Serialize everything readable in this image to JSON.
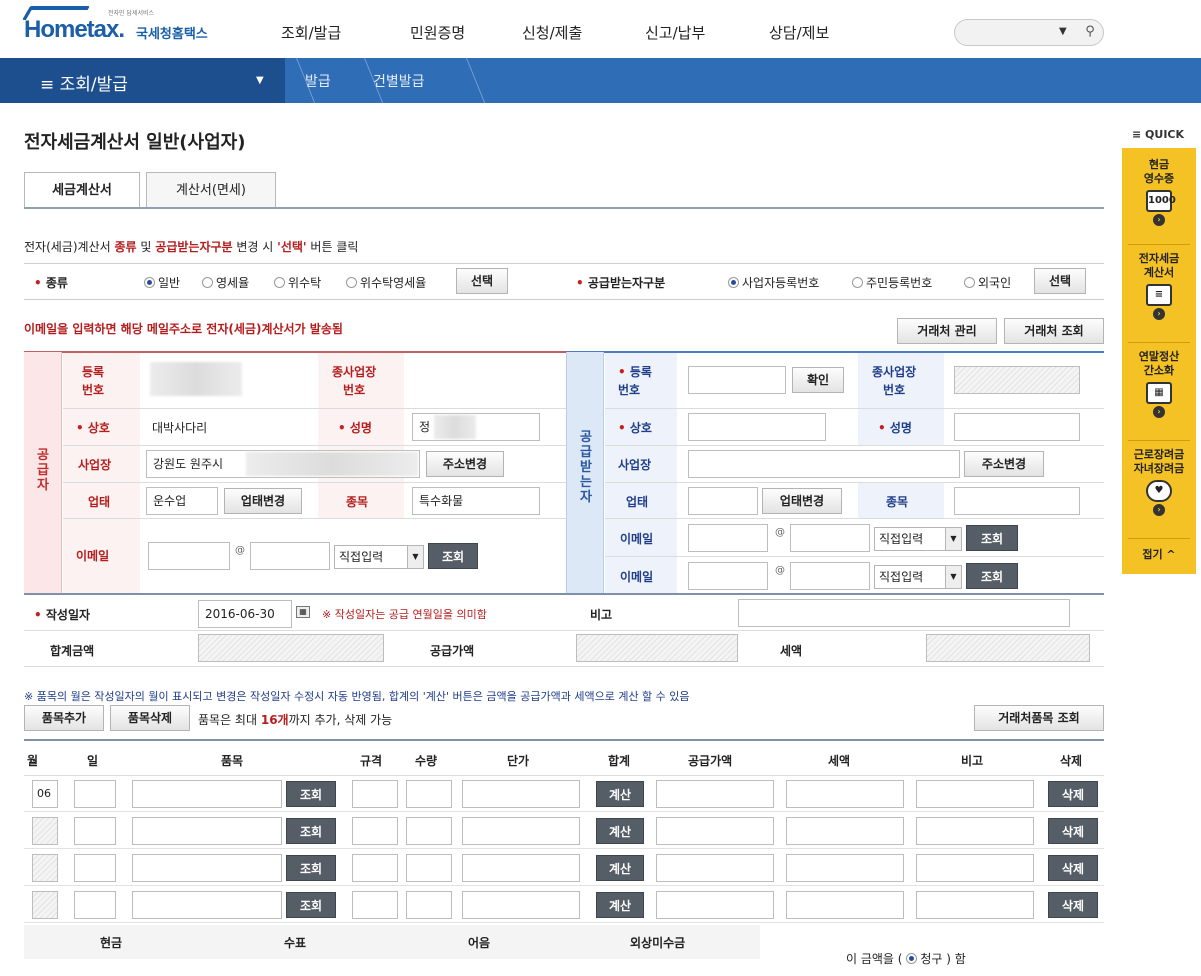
{
  "header": {
    "logo_text": "Hometax.",
    "logo_kr": "국세청홈택스",
    "logo_tagline": "전자민 답세서비스",
    "nav": [
      "조회/발급",
      "민원증명",
      "신청/제출",
      "신고/납부",
      "상담/제보"
    ]
  },
  "breadcrumb": {
    "menu": "조회/발급",
    "items": [
      "발급",
      "건별발급"
    ]
  },
  "page_title": "전자세금계산서 일반(사업자)",
  "tabs": [
    "세금계산서",
    "계산서(면세)"
  ],
  "quick": {
    "label": "QUICK",
    "items": [
      {
        "label": "현금\n영수증",
        "icon": "receipt-icon"
      },
      {
        "label": "전자세금\n계산서",
        "icon": "invoice-icon"
      },
      {
        "label": "연말정산\n간소화",
        "icon": "calculator-icon"
      },
      {
        "label": "근로장려금\n자녀장려금",
        "icon": "heart-icon"
      }
    ],
    "close": "접기"
  },
  "notice1": {
    "prefix": "전자(세금)계산서",
    "type": "종류",
    "and": "및",
    "recipient": "공급받는자구분",
    "mid": "변경 시",
    "select": "'선택'",
    "suffix": "버튼 클릭"
  },
  "kind": {
    "label": "종류",
    "options": [
      "일반",
      "영세율",
      "위수탁",
      "위수탁영세율"
    ],
    "select_button": "선택"
  },
  "recipient_type": {
    "label": "공급받는자구분",
    "options": [
      "사업자등록번호",
      "주민등록번호",
      "외국인"
    ],
    "select_button": "선택"
  },
  "email_notice": "이메일을 입력하면 해당 메일주소로 전자(세금)계산서가 발송됨",
  "partner_manage": "거래처 관리",
  "partner_lookup": "거래처 조회",
  "supplier": {
    "side_label": "공급자",
    "reg_label": "등록\n번호",
    "branch_label": "종사업장\n번호",
    "name_label": "상호",
    "name_value": "대박사다리",
    "ceo_label": "성명",
    "ceo_value": "정",
    "addr_label": "사업장",
    "addr_value": "강원도 원주시",
    "addr_button": "주소변경",
    "biz_label": "업태",
    "biz_value": "운수업",
    "biz_button": "업태변경",
    "item_label": "종목",
    "item_value": "특수화물",
    "email_label": "이메일",
    "at": "@",
    "email_select": "직접입력",
    "lookup": "조회"
  },
  "recipient": {
    "side_label": "공급받는자",
    "reg_label": "등록\n번호",
    "confirm": "확인",
    "branch_label": "종사업장\n번호",
    "name_label": "상호",
    "ceo_label": "성명",
    "addr_label": "사업장",
    "addr_button": "주소변경",
    "biz_label": "업태",
    "biz_button": "업태변경",
    "item_label": "종목",
    "email_label": "이메일",
    "at": "@",
    "email_select": "직접입력",
    "lookup": "조회"
  },
  "write_date": {
    "label": "작성일자",
    "value": "2016-06-30",
    "hint": "※ 작성일자는 공급 연월일을 의미함",
    "remark_label": "비고"
  },
  "totals": {
    "total_label": "합계금액",
    "supply_label": "공급가액",
    "tax_label": "세액"
  },
  "items_notice": "※ 품목의 월은 작성일자의 월이 표시되고 변경은 작성일자 수정시 자동 반영됨, 합계의 '계산' 버튼은 금액을 공급가액과 세액으로 계산 할 수 있음",
  "items_toolbar": {
    "add": "품목추가",
    "delete": "품목삭제",
    "info_prefix": "품목은 최대",
    "info_count": "16개",
    "info_suffix": "까지 추가, 삭제 가능",
    "lookup": "거래처품목 조회"
  },
  "items_table": {
    "headers": [
      "월",
      "일",
      "품목",
      "규격",
      "수량",
      "단가",
      "합계",
      "공급가액",
      "세액",
      "비고",
      "삭제"
    ],
    "first_month": "06",
    "lookup": "조회",
    "calc": "계산",
    "delete": "삭제",
    "rows": 4
  },
  "payment": {
    "headers": [
      "현금",
      "수표",
      "어음",
      "외상미수금"
    ],
    "claim_prefix": "이 금액을 (",
    "claim_option": "청구",
    "claim_suffix": ") 함"
  }
}
